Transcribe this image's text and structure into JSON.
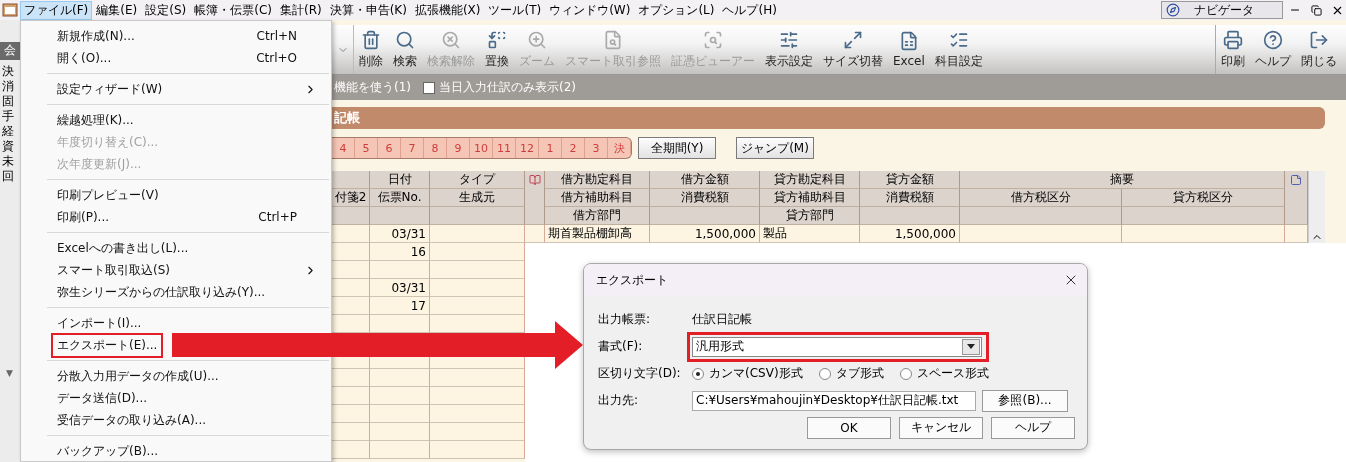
{
  "menubar": {
    "items": [
      {
        "label": "ファイル(F)",
        "selected": true
      },
      {
        "label": "編集(E)",
        "selected": false
      },
      {
        "label": "設定(S)",
        "selected": false
      },
      {
        "label": "帳簿・伝票(C)",
        "selected": false
      },
      {
        "label": "集計(R)",
        "selected": false
      },
      {
        "label": "決算・申告(K)",
        "selected": false
      },
      {
        "label": "拡張機能(X)",
        "selected": false
      },
      {
        "label": "ツール(T)",
        "selected": false
      },
      {
        "label": "ウィンドウ(W)",
        "selected": false
      },
      {
        "label": "オプション(L)",
        "selected": false
      },
      {
        "label": "ヘルプ(H)",
        "selected": false
      }
    ],
    "navigator": "ナビゲータ"
  },
  "side_panel": {
    "tab": "会",
    "items": [
      "決",
      "消",
      "固",
      "手",
      "経",
      "資",
      "未",
      "回"
    ],
    "collapse": "▼"
  },
  "file_menu": {
    "groups": [
      [
        {
          "label": "新規作成(N)...",
          "shortcut": "Ctrl+N",
          "disabled": false,
          "submenu": false,
          "highlighted": false
        },
        {
          "label": "開く(O)...",
          "shortcut": "Ctrl+O",
          "disabled": false,
          "submenu": false,
          "highlighted": false
        }
      ],
      [
        {
          "label": "設定ウィザード(W)",
          "disabled": false,
          "submenu": true,
          "highlighted": false
        }
      ],
      [
        {
          "label": "繰越処理(K)...",
          "disabled": false,
          "submenu": false,
          "highlighted": false
        },
        {
          "label": "年度切り替え(C)...",
          "disabled": true,
          "submenu": false,
          "highlighted": false
        },
        {
          "label": "次年度更新(J)...",
          "disabled": true,
          "submenu": false,
          "highlighted": false
        }
      ],
      [
        {
          "label": "印刷プレビュー(V)",
          "disabled": false,
          "submenu": false,
          "highlighted": false
        },
        {
          "label": "印刷(P)...",
          "shortcut": "Ctrl+P",
          "disabled": false,
          "submenu": false,
          "highlighted": false
        }
      ],
      [
        {
          "label": "Excelへの書き出し(L)...",
          "disabled": false,
          "submenu": false,
          "highlighted": false
        },
        {
          "label": "スマート取引取込(S)",
          "disabled": false,
          "submenu": true,
          "highlighted": false
        },
        {
          "label": "弥生シリーズからの仕訳取り込み(Y)...",
          "disabled": false,
          "submenu": false,
          "highlighted": false
        }
      ],
      [
        {
          "label": "インポート(I)...",
          "disabled": false,
          "submenu": false,
          "highlighted": false
        },
        {
          "label": "エクスポート(E)...",
          "disabled": false,
          "submenu": false,
          "highlighted": true
        }
      ],
      [
        {
          "label": "分散入力用データの作成(U)...",
          "disabled": false,
          "submenu": false,
          "highlighted": false
        },
        {
          "label": "データ送信(D)...",
          "disabled": false,
          "submenu": false,
          "highlighted": false
        },
        {
          "label": "受信データの取り込み(A)...",
          "disabled": false,
          "submenu": false,
          "highlighted": false
        }
      ],
      [
        {
          "label": "バックアップ(B)...",
          "disabled": false,
          "submenu": false,
          "highlighted": false
        }
      ]
    ]
  },
  "toolbar": {
    "items": [
      {
        "kind": "trash",
        "label": "削除",
        "disabled": false
      },
      {
        "kind": "search",
        "label": "検索",
        "disabled": false
      },
      {
        "kind": "search_clear",
        "label": "検索解除",
        "disabled": true
      },
      {
        "kind": "replace",
        "label": "置換",
        "disabled": false
      },
      {
        "kind": "zoom",
        "label": "ズーム",
        "disabled": true
      },
      {
        "kind": "smart_ref",
        "label": "スマート取引参照",
        "disabled": true
      },
      {
        "kind": "viewer",
        "label": "証憑ビューアー",
        "disabled": true
      },
      {
        "kind": "display",
        "label": "表示設定",
        "disabled": false
      },
      {
        "kind": "resize",
        "label": "サイズ切替",
        "disabled": false
      },
      {
        "kind": "excel",
        "label": "Excel",
        "disabled": false
      },
      {
        "kind": "accounts",
        "label": "科目設定",
        "disabled": false
      }
    ],
    "right_items": [
      {
        "kind": "print",
        "label": "印刷",
        "disabled": false
      },
      {
        "kind": "help",
        "label": "ヘルプ",
        "disabled": false
      },
      {
        "kind": "close",
        "label": "閉じる",
        "disabled": false
      }
    ]
  },
  "options": {
    "partial_label": "機能を使う(1)",
    "checkbox": {
      "label": "当日入力仕訳のみ表示(2)",
      "checked": false
    }
  },
  "journal": {
    "title": "記帳",
    "months": [
      "4",
      "5",
      "6",
      "7",
      "8",
      "9",
      "10",
      "11",
      "12",
      "1",
      "2",
      "3",
      "決"
    ],
    "buttons": [
      "全期間(Y)",
      "ジャンプ(M)"
    ]
  },
  "table": {
    "columns": [
      {
        "kind": "text",
        "line2": "付箋2"
      },
      {
        "kind": "text",
        "line1": "日付",
        "line2": "伝票No."
      },
      {
        "kind": "text",
        "line1": "タイプ",
        "line2": "生成元"
      },
      {
        "kind": "tag"
      },
      {
        "kind": "text",
        "line1": "借方勘定科目",
        "line2": "借方補助科目",
        "line3": "借方部門"
      },
      {
        "kind": "text",
        "line1": "借方金額",
        "line2": "消費税額"
      },
      {
        "kind": "text",
        "line1": "貸方勘定科目",
        "line2": "貸方補助科目",
        "line3": "貸方部門"
      },
      {
        "kind": "text",
        "line1": "貸方金額",
        "line2": "消費税額"
      },
      {
        "kind": "summary",
        "line1": "摘要",
        "sub": [
          "借方税区分",
          "貸方税区分"
        ]
      },
      {
        "kind": "memo"
      }
    ],
    "rows": [
      {
        "date": "03/31",
        "slip_no": "16",
        "debit_account": "期首製品棚卸高",
        "debit_amount": "1,500,000",
        "credit_account": "製品",
        "credit_amount": "1,500,000"
      },
      {
        "date": "03/31",
        "slip_no": "17"
      }
    ]
  },
  "export_dialog": {
    "title": "エクスポート",
    "report": {
      "label": "出力帳票:",
      "value": "仕訳日記帳"
    },
    "format": {
      "label": "書式(F):",
      "value": "汎用形式",
      "highlighted": true
    },
    "delimiter": {
      "label": "区切り文字(D):",
      "options": [
        {
          "label": "カンマ(CSV)形式",
          "selected": true
        },
        {
          "label": "タブ形式",
          "selected": false
        },
        {
          "label": "スペース形式",
          "selected": false
        }
      ]
    },
    "destination": {
      "label": "出力先:",
      "value": "C:¥Users¥mahoujin¥Desktop¥仕訳日記帳.txt",
      "browse": "参照(B)..."
    },
    "buttons": [
      "OK",
      "キャンセル",
      "ヘルプ"
    ]
  }
}
